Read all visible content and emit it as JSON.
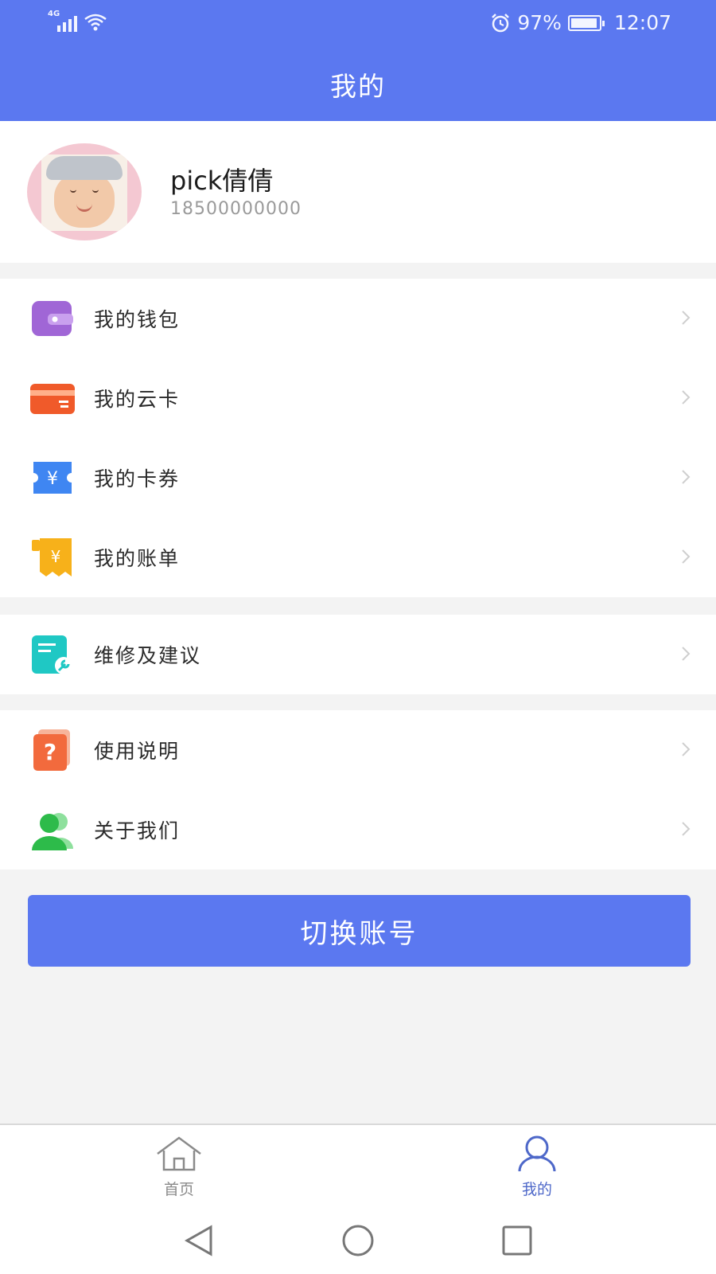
{
  "status_bar": {
    "network": "4G",
    "alarm_icon": "alarm-icon",
    "battery_percent": "97%",
    "time": "12:07"
  },
  "header": {
    "title": "我的"
  },
  "profile": {
    "name": "pick倩倩",
    "phone": "18500000000"
  },
  "menu_groups": [
    [
      {
        "label": "我的钱包",
        "icon": "wallet-icon",
        "color": "#a066d6"
      },
      {
        "label": "我的云卡",
        "icon": "card-icon",
        "color": "#f05a2a"
      },
      {
        "label": "我的卡券",
        "icon": "coupon-icon",
        "color": "#3f86f2"
      },
      {
        "label": "我的账单",
        "icon": "bill-icon",
        "color": "#f7b11a"
      }
    ],
    [
      {
        "label": "维修及建议",
        "icon": "repair-icon",
        "color": "#1fc8c4"
      }
    ],
    [
      {
        "label": "使用说明",
        "icon": "help-icon",
        "color": "#f26a3d"
      },
      {
        "label": "关于我们",
        "icon": "about-icon",
        "color": "#2dbb4a"
      }
    ]
  ],
  "switch_button": {
    "label": "切换账号"
  },
  "tab_bar": {
    "tabs": [
      {
        "label": "首页",
        "icon": "home-icon",
        "active": false
      },
      {
        "label": "我的",
        "icon": "user-icon",
        "active": true
      }
    ]
  },
  "colors": {
    "primary": "#5b78f0",
    "active_tab": "#4e68c9"
  }
}
